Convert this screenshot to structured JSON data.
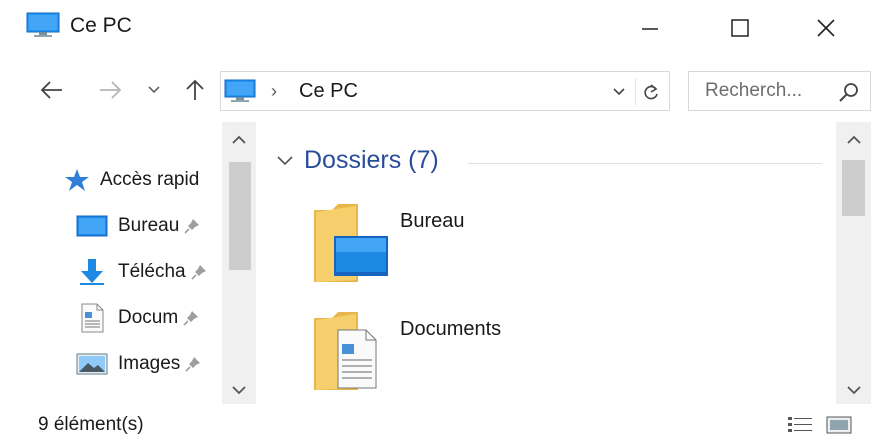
{
  "window": {
    "title": "Ce PC",
    "icon": "computer-icon"
  },
  "titlebar": {
    "minimize_icon": "minimize-icon",
    "maximize_icon": "maximize-icon",
    "close_icon": "close-icon"
  },
  "navigation": {
    "back_icon": "arrow-left-icon",
    "forward_icon": "arrow-right-icon",
    "recent_icon": "chevron-down-icon",
    "up_icon": "arrow-up-icon"
  },
  "address": {
    "separator": "›",
    "location": "Ce PC",
    "dropdown_icon": "chevron-down-icon",
    "refresh_icon": "refresh-icon"
  },
  "search": {
    "placeholder": "Recherch...",
    "icon": "search-icon"
  },
  "sidebar": {
    "items": [
      {
        "label": "Accès rapid",
        "icon": "star-icon",
        "pinned": false
      },
      {
        "label": "Bureau",
        "icon": "desktop-icon",
        "pinned": true
      },
      {
        "label": "Télécha",
        "icon": "download-icon",
        "pinned": true
      },
      {
        "label": "Docum",
        "icon": "document-icon",
        "pinned": true
      },
      {
        "label": "Images",
        "icon": "image-icon",
        "pinned": true
      }
    ]
  },
  "content": {
    "group_title": "Dossiers (7)",
    "folders": [
      {
        "label": "Bureau",
        "icon": "desktop-folder-icon"
      },
      {
        "label": "Documents",
        "icon": "documents-folder-icon"
      }
    ]
  },
  "status": {
    "item_count": "9 élément(s)",
    "view_details_icon": "details-view-icon",
    "view_tiles_icon": "large-icons-view-icon"
  },
  "colors": {
    "accent": "#2a4d9a",
    "folder": "#f0c75e",
    "desktop_blue": "#1e88e5",
    "star": "#2f7fd8"
  }
}
